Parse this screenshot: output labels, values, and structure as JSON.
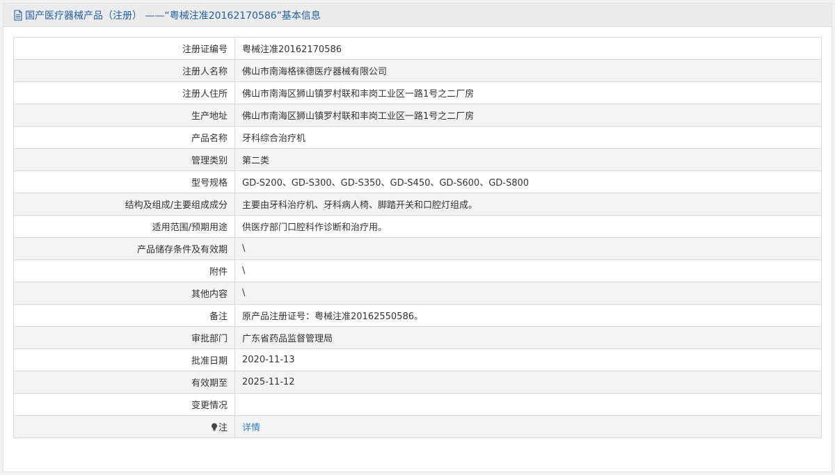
{
  "header": {
    "icon": "document-icon",
    "title": "国产医疗器械产品（注册） ——“粤械注准20162170586”基本信息"
  },
  "rows": [
    {
      "label": "注册证编号",
      "value": "粤械注准20162170586"
    },
    {
      "label": "注册人名称",
      "value": "佛山市南海格徕德医疗器械有限公司"
    },
    {
      "label": "注册人住所",
      "value": "佛山市南海区狮山镇罗村联和丰岗工业区一路1号之二厂房"
    },
    {
      "label": "生产地址",
      "value": "佛山市南海区狮山镇罗村联和丰岗工业区一路1号之二厂房"
    },
    {
      "label": "产品名称",
      "value": "牙科综合治疗机"
    },
    {
      "label": "管理类别",
      "value": "第二类"
    },
    {
      "label": "型号规格",
      "value": "GD-S200、GD-S300、GD-S350、GD-S450、GD-S600、GD-S800"
    },
    {
      "label": "结构及组成/主要组成成分",
      "value": "主要由牙科治疗机、牙科病人椅、脚踏开关和口腔灯组成。"
    },
    {
      "label": "适用范围/预期用途",
      "value": "供医疗部门口腔科作诊断和治疗用。"
    },
    {
      "label": "产品储存条件及有效期",
      "value": "\\"
    },
    {
      "label": "附件",
      "value": "\\"
    },
    {
      "label": "其他内容",
      "value": "\\"
    },
    {
      "label": "备注",
      "value": "原产品注册证号：粤械注准20162550586。"
    },
    {
      "label": "审批部门",
      "value": "广东省药品监督管理局"
    },
    {
      "label": "批准日期",
      "value": "2020-11-13"
    },
    {
      "label": "有效期至",
      "value": "2025-11-12"
    },
    {
      "label": "变更情况",
      "value": ""
    }
  ],
  "note_row": {
    "icon": "bulb-icon",
    "label": "注",
    "link_text": "详情"
  },
  "colors": {
    "header_text": "#1f5fa8",
    "link": "#2a7fd4",
    "row_alt": "#f4f4f4",
    "border": "#d9d9d9"
  }
}
